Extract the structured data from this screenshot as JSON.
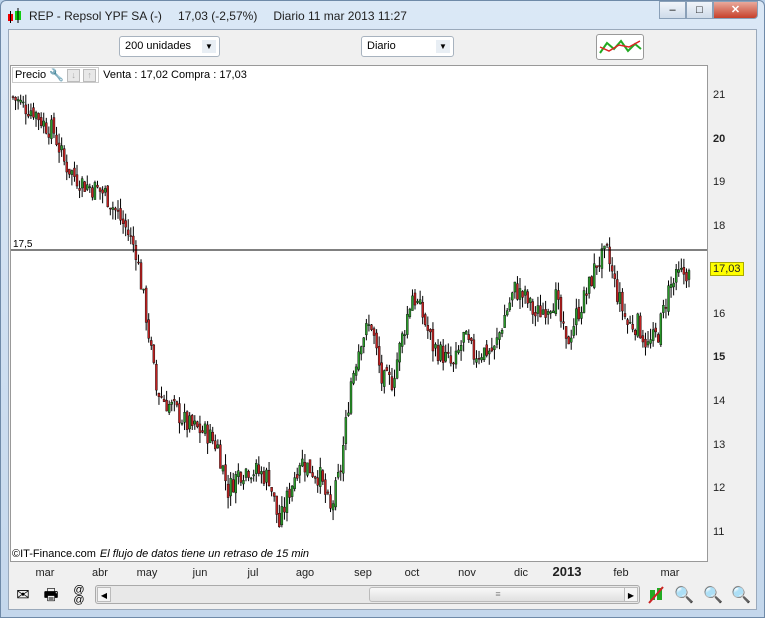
{
  "window": {
    "symbol": "REP - Repsol YPF SA (-)",
    "price_change": "17,03 (-2,57%)",
    "period_time": "Diario  11 mar 2013 11:27",
    "minimize": "–",
    "maximize": "□",
    "close": "✕"
  },
  "controls": {
    "units": "200 unidades",
    "period": "Diario"
  },
  "info": {
    "precio_label": "Precio",
    "quote": "Venta : 17,02 Compra : 17,03"
  },
  "footer": {
    "copyright": "©IT-Finance.com",
    "delay_note": "El flujo de datos tiene un retraso de 15 min"
  },
  "colors": {
    "up": "#2a9a2a",
    "down": "#c02020",
    "last_price_bg": "#ffff00"
  },
  "chart_data": {
    "type": "candlestick",
    "symbol": "REP",
    "y_ticks": [
      21,
      20,
      19,
      18,
      17,
      16,
      15,
      14,
      13,
      12,
      11
    ],
    "ylim": [
      10.8,
      21.3
    ],
    "x_labels": [
      "mar",
      "abr",
      "may",
      "jun",
      "jul",
      "ago",
      "sep",
      "oct",
      "nov",
      "dic",
      "2013",
      "feb",
      "mar"
    ],
    "horizontal_line": {
      "value": 17.5,
      "label": "17,5"
    },
    "last_price": {
      "value": 17.03,
      "label": "17,03"
    },
    "approx_closes": [
      21.0,
      20.8,
      20.7,
      20.4,
      20.2,
      19.5,
      19.2,
      19.0,
      18.9,
      18.8,
      18.4,
      18.0,
      17.5,
      16.0,
      14.3,
      14.0,
      13.8,
      13.5,
      13.4,
      13.3,
      13.0,
      12.0,
      12.4,
      12.5,
      12.4,
      12.3,
      11.2,
      12.0,
      12.7,
      12.5,
      12.3,
      11.5,
      12.5,
      14.5,
      15.5,
      15.8,
      14.5,
      14.5,
      15.5,
      16.5,
      16.0,
      15.3,
      15.1,
      14.8,
      15.5,
      15.1,
      15.2,
      15.2,
      16.0,
      16.6,
      16.4,
      16.0,
      16.2,
      16.4,
      15.3,
      16.0,
      16.5,
      17.2,
      17.4,
      16.5,
      15.8,
      15.8,
      15.3,
      15.6,
      16.6,
      16.9,
      17.03
    ]
  }
}
